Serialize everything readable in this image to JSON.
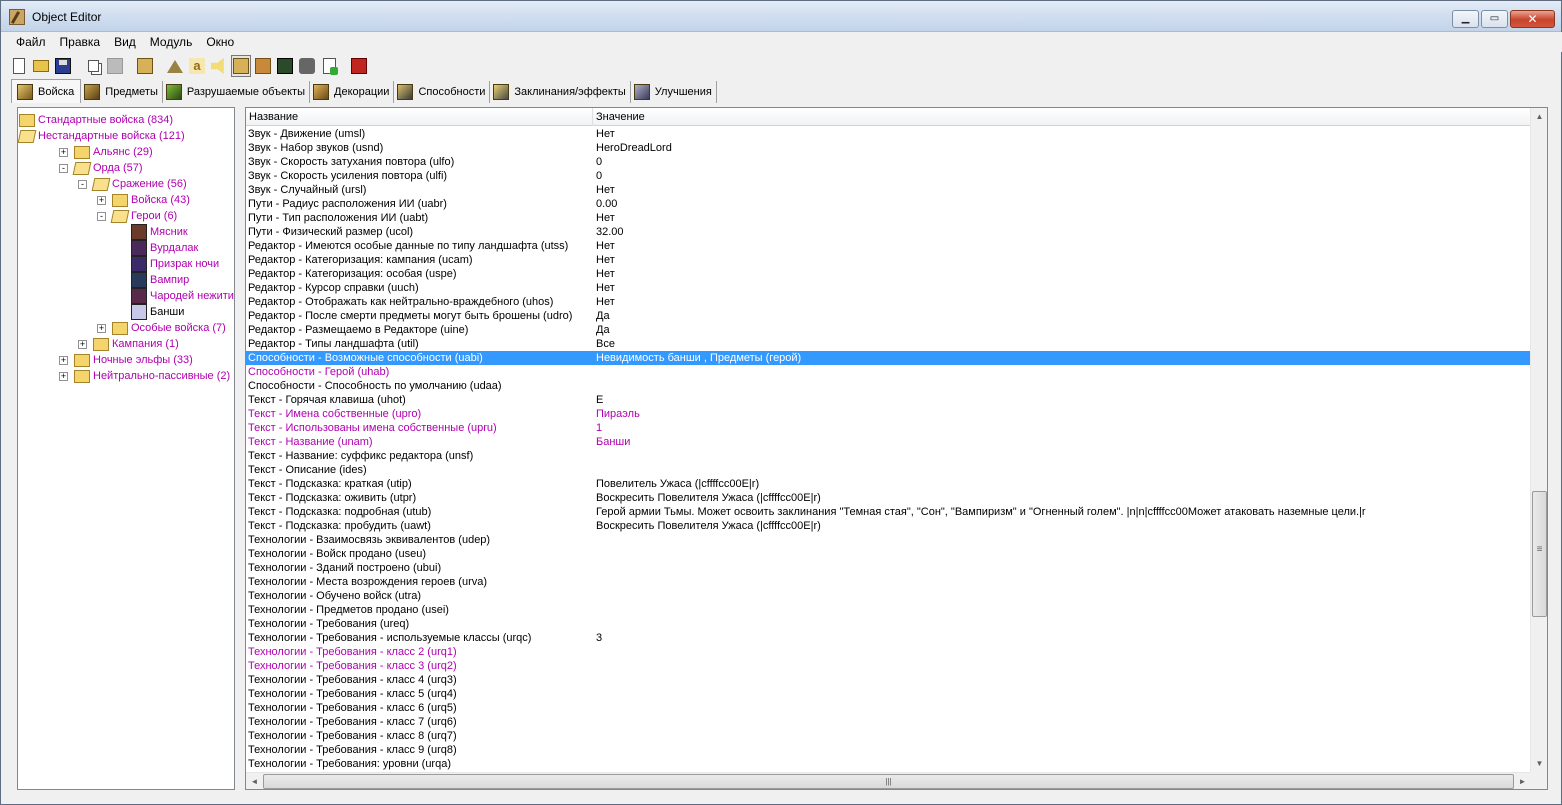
{
  "window": {
    "title": "Object Editor",
    "buttons": {
      "minimize": "▁",
      "maximize": "▭",
      "close": "✕"
    }
  },
  "menu": [
    "Файл",
    "Правка",
    "Вид",
    "Модуль",
    "Окно"
  ],
  "toolbar": {
    "buttons": [
      "new-icon",
      "open-icon",
      "save-icon",
      "copy-icon",
      "paste-icon",
      "units-icon",
      "terrain-icon",
      "letter-icon",
      "sound-icon",
      "unit-portrait-icon",
      "doodad-icon",
      "tileset-icon",
      "rock-icon",
      "import-icon",
      "book-icon"
    ],
    "letter_glyph": "a"
  },
  "tabs": [
    {
      "label": "Войска",
      "active": true
    },
    {
      "label": "Предметы",
      "active": false
    },
    {
      "label": "Разрушаемые объекты",
      "active": false
    },
    {
      "label": "Декорации",
      "active": false
    },
    {
      "label": "Способности",
      "active": false
    },
    {
      "label": "Заклинания/эффекты",
      "active": false
    },
    {
      "label": "Улучшения",
      "active": false
    }
  ],
  "tree": [
    {
      "label": "Стандартные войска (834)",
      "level": 0,
      "kind": "folder",
      "expander": "",
      "color": "magenta"
    },
    {
      "label": "Нестандартные войска (121)",
      "level": 0,
      "kind": "folder-open",
      "expander": "",
      "color": "magenta"
    },
    {
      "label": "Альянс (29)",
      "level": 1,
      "kind": "folder",
      "expander": "+",
      "color": "magenta"
    },
    {
      "label": "Орда (57)",
      "level": 1,
      "kind": "folder-open",
      "expander": "-",
      "color": "magenta"
    },
    {
      "label": "Сражение (56)",
      "level": 2,
      "kind": "folder-open",
      "expander": "-",
      "color": "magenta"
    },
    {
      "label": "Войска (43)",
      "level": 3,
      "kind": "folder",
      "expander": "+",
      "color": "magenta"
    },
    {
      "label": "Герои (6)",
      "level": 3,
      "kind": "folder-open",
      "expander": "-",
      "color": "magenta"
    },
    {
      "label": "Мясник",
      "level": 4,
      "kind": "unit",
      "expander": "",
      "color": "magenta",
      "icon_color": "#6a3a2a"
    },
    {
      "label": "Вурдалак",
      "level": 4,
      "kind": "unit",
      "expander": "",
      "color": "magenta",
      "icon_color": "#4a2a5a"
    },
    {
      "label": "Призрак ночи",
      "level": 4,
      "kind": "unit",
      "expander": "",
      "color": "magenta",
      "icon_color": "#3a2a6a"
    },
    {
      "label": "Вампир",
      "level": 4,
      "kind": "unit",
      "expander": "",
      "color": "magenta",
      "icon_color": "#2a3a5a"
    },
    {
      "label": "Чародей нежити",
      "level": 4,
      "kind": "unit",
      "expander": "",
      "color": "magenta",
      "icon_color": "#5a2a4a"
    },
    {
      "label": "Банши",
      "level": 4,
      "kind": "unit",
      "expander": "",
      "color": "black",
      "icon_color": "#c8c8e8"
    },
    {
      "label": "Особые войска (7)",
      "level": 3,
      "kind": "folder",
      "expander": "+",
      "color": "magenta"
    },
    {
      "label": "Кампания (1)",
      "level": 2,
      "kind": "folder",
      "expander": "+",
      "color": "magenta"
    },
    {
      "label": "Ночные эльфы (33)",
      "level": 1,
      "kind": "folder",
      "expander": "+",
      "color": "magenta"
    },
    {
      "label": "Нейтрально-пассивные (2)",
      "level": 1,
      "kind": "folder",
      "expander": "+",
      "color": "magenta"
    }
  ],
  "grid": {
    "columns": [
      "Название",
      "Значение"
    ],
    "rows": [
      {
        "name": "Звук - Движение (umsl)",
        "value": "Нет",
        "state": "normal"
      },
      {
        "name": "Звук - Набор звуков (usnd)",
        "value": "HeroDreadLord",
        "state": "normal"
      },
      {
        "name": "Звук - Скорость затухания повтора (ulfo)",
        "value": "0",
        "state": "normal"
      },
      {
        "name": "Звук - Скорость усиления повтора (ulfi)",
        "value": "0",
        "state": "normal"
      },
      {
        "name": "Звук - Случайный (ursl)",
        "value": "Нет",
        "state": "normal"
      },
      {
        "name": "Пути - Радиус расположения ИИ (uabr)",
        "value": "0.00",
        "state": "normal"
      },
      {
        "name": "Пути - Тип расположения ИИ (uabt)",
        "value": "Нет",
        "state": "normal"
      },
      {
        "name": "Пути - Физический размер (ucol)",
        "value": "32.00",
        "state": "normal"
      },
      {
        "name": "Редактор - Имеются особые данные по типу ландшафта (utss)",
        "value": "Нет",
        "state": "normal"
      },
      {
        "name": "Редактор - Категоризация: кампания (ucam)",
        "value": "Нет",
        "state": "normal"
      },
      {
        "name": "Редактор - Категоризация: особая (uspe)",
        "value": "Нет",
        "state": "normal"
      },
      {
        "name": "Редактор - Курсор справки (uuch)",
        "value": "Нет",
        "state": "normal"
      },
      {
        "name": "Редактор - Отображать как нейтрально-враждебного (uhos)",
        "value": "Нет",
        "state": "normal"
      },
      {
        "name": "Редактор - После смерти предметы могут быть брошены (udro)",
        "value": "Да",
        "state": "normal"
      },
      {
        "name": "Редактор - Размещаемо в Редакторе (uine)",
        "value": "Да",
        "state": "normal"
      },
      {
        "name": "Редактор - Типы ландшафта (util)",
        "value": "Все",
        "state": "normal"
      },
      {
        "name": "Способности - Возможные способности (uabi)",
        "value": "Невидимость банши , Предметы (герой)",
        "state": "selected"
      },
      {
        "name": "Способности - Герой (uhab)",
        "value": "",
        "state": "modified"
      },
      {
        "name": "Способности - Способность по умолчанию (udaa)",
        "value": "",
        "state": "normal"
      },
      {
        "name": "Текст - Горячая клавиша (uhot)",
        "value": "E",
        "state": "normal"
      },
      {
        "name": "Текст - Имена собственные (upro)",
        "value": "Пираэль",
        "state": "modified"
      },
      {
        "name": "Текст - Использованы имена собственные (upru)",
        "value": "1",
        "state": "modified"
      },
      {
        "name": "Текст - Название (unam)",
        "value": "Банши",
        "state": "modified"
      },
      {
        "name": "Текст - Название: суффикс редактора (unsf)",
        "value": "",
        "state": "normal"
      },
      {
        "name": "Текст - Описание (ides)",
        "value": "",
        "state": "normal"
      },
      {
        "name": "Текст - Подсказка: краткая (utip)",
        "value": "Повелитель Ужаса (|cffffcc00E|r)",
        "state": "normal"
      },
      {
        "name": "Текст - Подсказка: оживить (utpr)",
        "value": "Воскресить Повелителя Ужаса (|cffffcc00E|r)",
        "state": "normal"
      },
      {
        "name": "Текст - Подсказка: подробная (utub)",
        "value": "Герой армии Тьмы. Может освоить заклинания \"Темная стая\", \"Сон\", \"Вампиризм\" и \"Огненный голем\". |n|n|cffffcc00Может атаковать наземные цели.|r",
        "state": "normal"
      },
      {
        "name": "Текст - Подсказка: пробудить (uawt)",
        "value": "Воскресить Повелителя Ужаса (|cffffcc00E|r)",
        "state": "normal"
      },
      {
        "name": "Технологии - Взаимосвязь эквивалентов (udep)",
        "value": "",
        "state": "normal"
      },
      {
        "name": "Технологии - Войск продано (useu)",
        "value": "",
        "state": "normal"
      },
      {
        "name": "Технологии - Зданий построено (ubui)",
        "value": "",
        "state": "normal"
      },
      {
        "name": "Технологии - Места возрождения героев (urva)",
        "value": "",
        "state": "normal"
      },
      {
        "name": "Технологии - Обучено войск (utra)",
        "value": "",
        "state": "normal"
      },
      {
        "name": "Технологии - Предметов продано (usei)",
        "value": "",
        "state": "normal"
      },
      {
        "name": "Технологии - Требования (ureq)",
        "value": "",
        "state": "normal"
      },
      {
        "name": "Технологии - Требования - используемые классы (urqc)",
        "value": "3",
        "state": "normal"
      },
      {
        "name": "Технологии - Требования - класс 2 (urq1)",
        "value": "",
        "state": "modified"
      },
      {
        "name": "Технологии - Требования - класс 3 (urq2)",
        "value": "",
        "state": "modified"
      },
      {
        "name": "Технологии - Требования - класс 4 (urq3)",
        "value": "",
        "state": "normal"
      },
      {
        "name": "Технологии - Требования - класс 5 (urq4)",
        "value": "",
        "state": "normal"
      },
      {
        "name": "Технологии - Требования - класс 6 (urq5)",
        "value": "",
        "state": "normal"
      },
      {
        "name": "Технологии - Требования - класс 7 (urq6)",
        "value": "",
        "state": "normal"
      },
      {
        "name": "Технологии - Требования - класс 8 (urq7)",
        "value": "",
        "state": "normal"
      },
      {
        "name": "Технологии - Требования - класс 9 (urq8)",
        "value": "",
        "state": "normal"
      },
      {
        "name": "Технологии - Требования: уровни (urqa)",
        "value": "",
        "state": "normal"
      }
    ]
  },
  "scrollbars": {
    "vertical": {
      "up": "▲",
      "down": "▼",
      "grip": "≡"
    },
    "horizontal": {
      "left": "◄",
      "right": "►",
      "grip": "|||"
    }
  },
  "colors": {
    "modified_text": "#b000b0",
    "selection": "#3399ff"
  }
}
